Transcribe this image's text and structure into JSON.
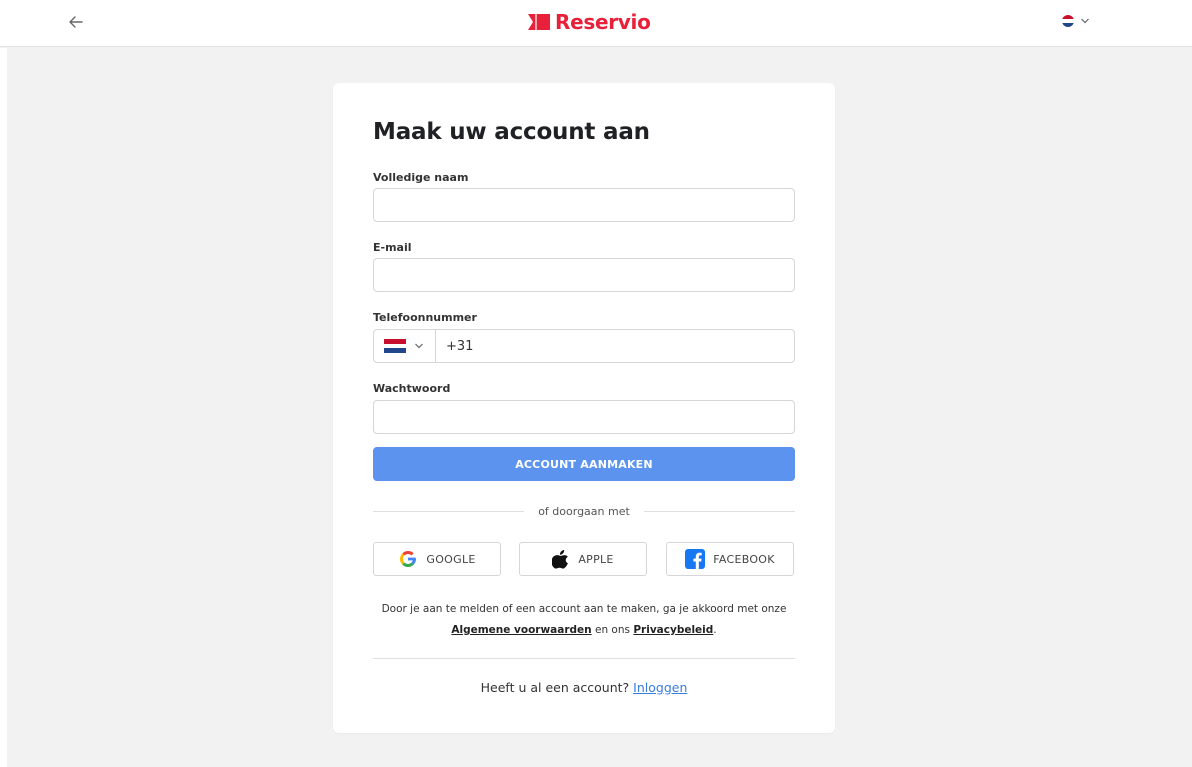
{
  "header": {
    "back_icon": "arrow-left-icon",
    "logo_text": "Reservio",
    "logo_icon": "ticket-flag-icon",
    "language_flag": "nl-flag-icon",
    "language_dropdown_icon": "chevron-down-icon"
  },
  "form": {
    "title": "Maak uw account aan",
    "full_name": {
      "label": "Volledige naam",
      "value": ""
    },
    "email": {
      "label": "E-mail",
      "value": ""
    },
    "phone": {
      "label": "Telefoonnummer",
      "country_flag": "nl-flag-icon",
      "value": "+31"
    },
    "password": {
      "label": "Wachtwoord",
      "value": ""
    },
    "submit_label": "ACCOUNT AANMAKEN",
    "divider_text": "of doorgaan met",
    "social": {
      "google": "GOOGLE",
      "apple": "APPLE",
      "facebook": "FACEBOOK"
    },
    "terms": {
      "line1": "Door je aan te melden of een account aan te maken, ga je akkoord met onze",
      "terms_link": "Algemene voorwaarden",
      "and_text": "en ons",
      "privacy_link": "Privacybeleid",
      "end": "."
    },
    "login": {
      "question": "Heeft u al een account?",
      "link": "Inloggen"
    }
  },
  "colors": {
    "brand": "#e8203a",
    "primary_button": "#5b93ef",
    "link": "#3a7be0",
    "background": "#f2f2f2"
  }
}
